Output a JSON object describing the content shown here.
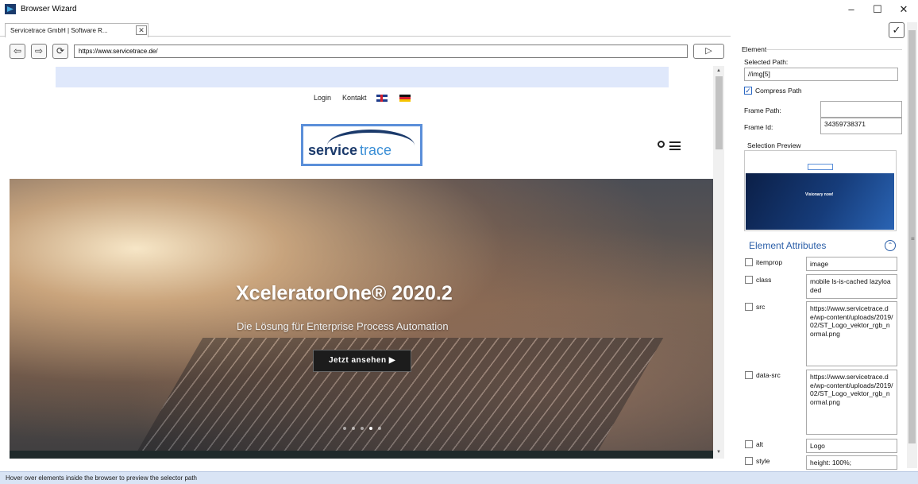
{
  "window": {
    "title": "Browser Wizard",
    "minimize": "–",
    "maximize": "☐",
    "close": "✕"
  },
  "tab": {
    "label": "Servicetrace GmbH | Software R...",
    "close": "✕"
  },
  "toolbar": {
    "back": "⇦",
    "forward": "⇨",
    "refresh": "⟳",
    "url": "https://www.servicetrace.de/",
    "go": "▷"
  },
  "page": {
    "nav": {
      "login": "Login",
      "kontakt": "Kontakt"
    },
    "logo": {
      "part1": "service",
      "part2": "trace"
    },
    "hero": {
      "title": "XceleratorOne® 2020.2",
      "subtitle": "Die Lösung für Enterprise Process Automation",
      "button": "Jetzt ansehen ▶"
    },
    "carousel": {
      "slides": 5,
      "active": 4
    }
  },
  "panel": {
    "confirm": "✓",
    "group": "Element",
    "selected_path_label": "Selected Path:",
    "selected_path_value": "//img[5]",
    "compress_label": "Compress Path",
    "compress_checked": true,
    "frame_path_label": "Frame Path:",
    "frame_path_value": "",
    "frame_id_label": "Frame Id:",
    "frame_id_value": "34359738371",
    "preview_label": "Selection Preview",
    "preview_text": "Visionary now!",
    "attributes_heading": "Element Attributes",
    "collapse": "⌃",
    "attributes": [
      {
        "name": "itemprop",
        "value": "image"
      },
      {
        "name": "class",
        "value": "mobile ls-is-cached lazyloaded"
      },
      {
        "name": "src",
        "value": "https://www.servicetrace.de/wp-content/uploads/2019/02/ST_Logo_vektor_rgb_normal.png"
      },
      {
        "name": "data-src",
        "value": "https://www.servicetrace.de/wp-content/uploads/2019/02/ST_Logo_vektor_rgb_normal.png"
      },
      {
        "name": "alt",
        "value": "Logo"
      },
      {
        "name": "style",
        "value": "height: 100%;"
      }
    ]
  },
  "status": {
    "text": "Hover over elements inside the browser to preview the selector path"
  },
  "colors": {
    "accent": "#2a5ea8",
    "status_bar": "#d9e4f5",
    "top_band": "#dfe8fb"
  }
}
